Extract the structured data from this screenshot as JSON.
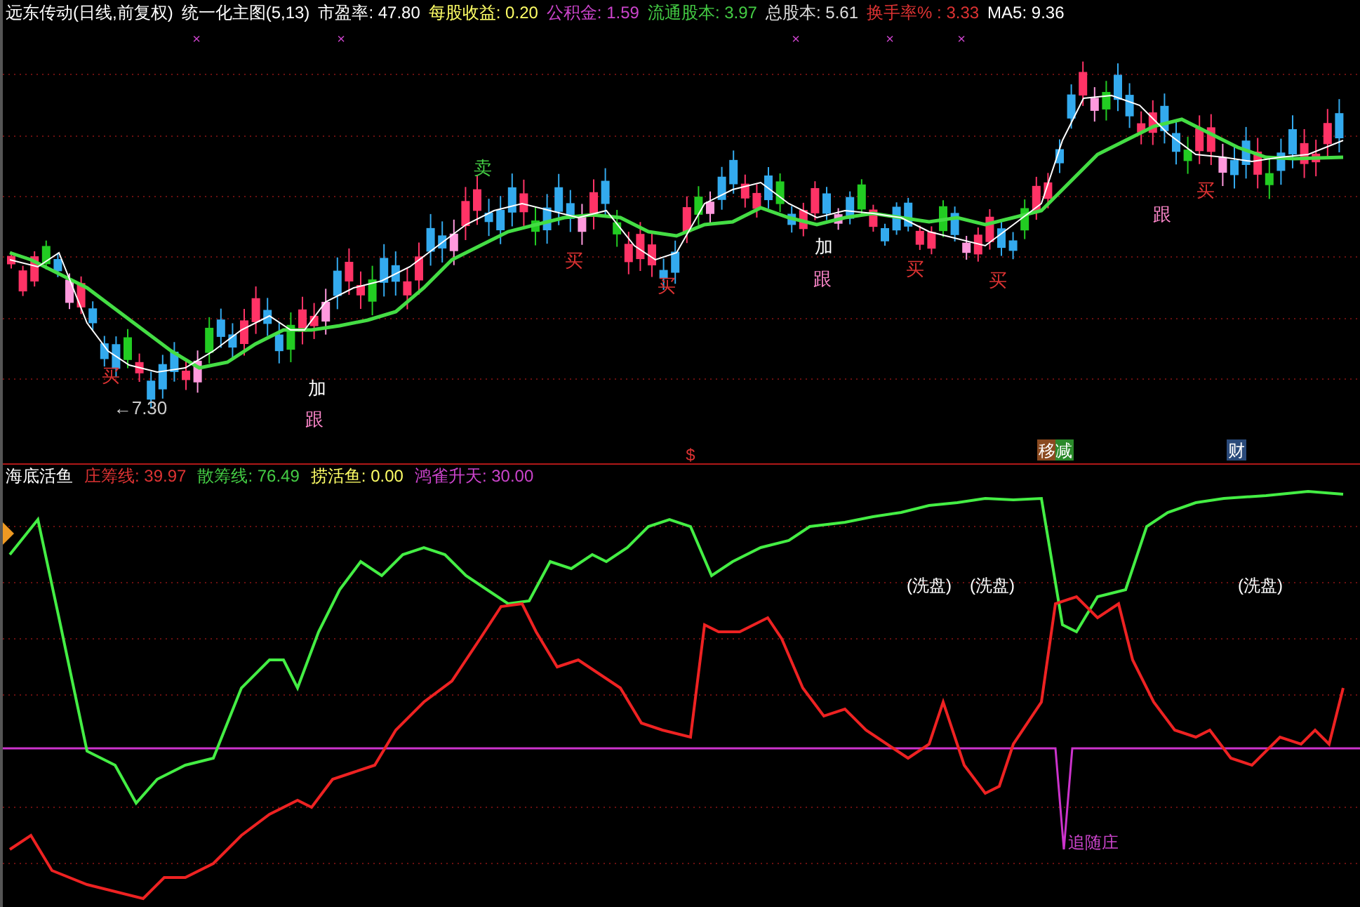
{
  "header": {
    "title": "远东传动(日线,前复权)",
    "indicator": "统一化主图(5,13)",
    "stats": [
      {
        "text": "市盈率: 47.80",
        "color": "#ffffff"
      },
      {
        "text": "每股收益: 0.20",
        "color": "#ffff66"
      },
      {
        "text": "公积金: 1.59",
        "color": "#cc44cc"
      },
      {
        "text": "流通股本: 3.97",
        "color": "#44cc44"
      },
      {
        "text": "总股本: 5.61",
        "color": "#dddddd"
      },
      {
        "text": "换手率% : 3.33",
        "color": "#dd3333"
      },
      {
        "text": "MA5: 9.36",
        "color": "#ffffff"
      }
    ],
    "marks": [
      "×",
      "×",
      "×",
      "×",
      "×"
    ]
  },
  "main_chart": {
    "labels": [
      {
        "text": "卖",
        "kind": "sell"
      },
      {
        "text": "买",
        "kind": "buy"
      },
      {
        "text": "买",
        "kind": "buy"
      },
      {
        "text": "买",
        "kind": "buy"
      },
      {
        "text": "买",
        "kind": "buy"
      },
      {
        "text": "买",
        "kind": "buy"
      },
      {
        "text": "买",
        "kind": "buy"
      },
      {
        "text": "加",
        "kind": "add"
      },
      {
        "text": "加",
        "kind": "add"
      },
      {
        "text": "跟",
        "kind": "follow"
      },
      {
        "text": "跟",
        "kind": "follow"
      },
      {
        "text": "跟",
        "kind": "follow"
      },
      {
        "text": "←7.30",
        "kind": "price"
      }
    ]
  },
  "event_markers": [
    {
      "text": "$",
      "kind": "dollar"
    },
    {
      "text": "移减",
      "kind": "split"
    },
    {
      "text": "财",
      "kind": "report"
    }
  ],
  "indicator_panel": {
    "title": "海底活鱼",
    "stats": [
      {
        "text": "庄筹线: 39.97",
        "color": "#dd3333"
      },
      {
        "text": "散筹线: 76.49",
        "color": "#44cc44"
      },
      {
        "text": "捞活鱼: 0.00",
        "color": "#ffff66"
      },
      {
        "text": "鸿雀升天: 30.00",
        "color": "#cc44cc"
      }
    ],
    "labels": [
      {
        "text": "(洗盘)",
        "kind": "wash"
      },
      {
        "text": "(洗盘)",
        "kind": "wash"
      },
      {
        "text": "(洗盘)",
        "kind": "wash"
      },
      {
        "text": "追随庄",
        "kind": "chase"
      }
    ]
  }
}
